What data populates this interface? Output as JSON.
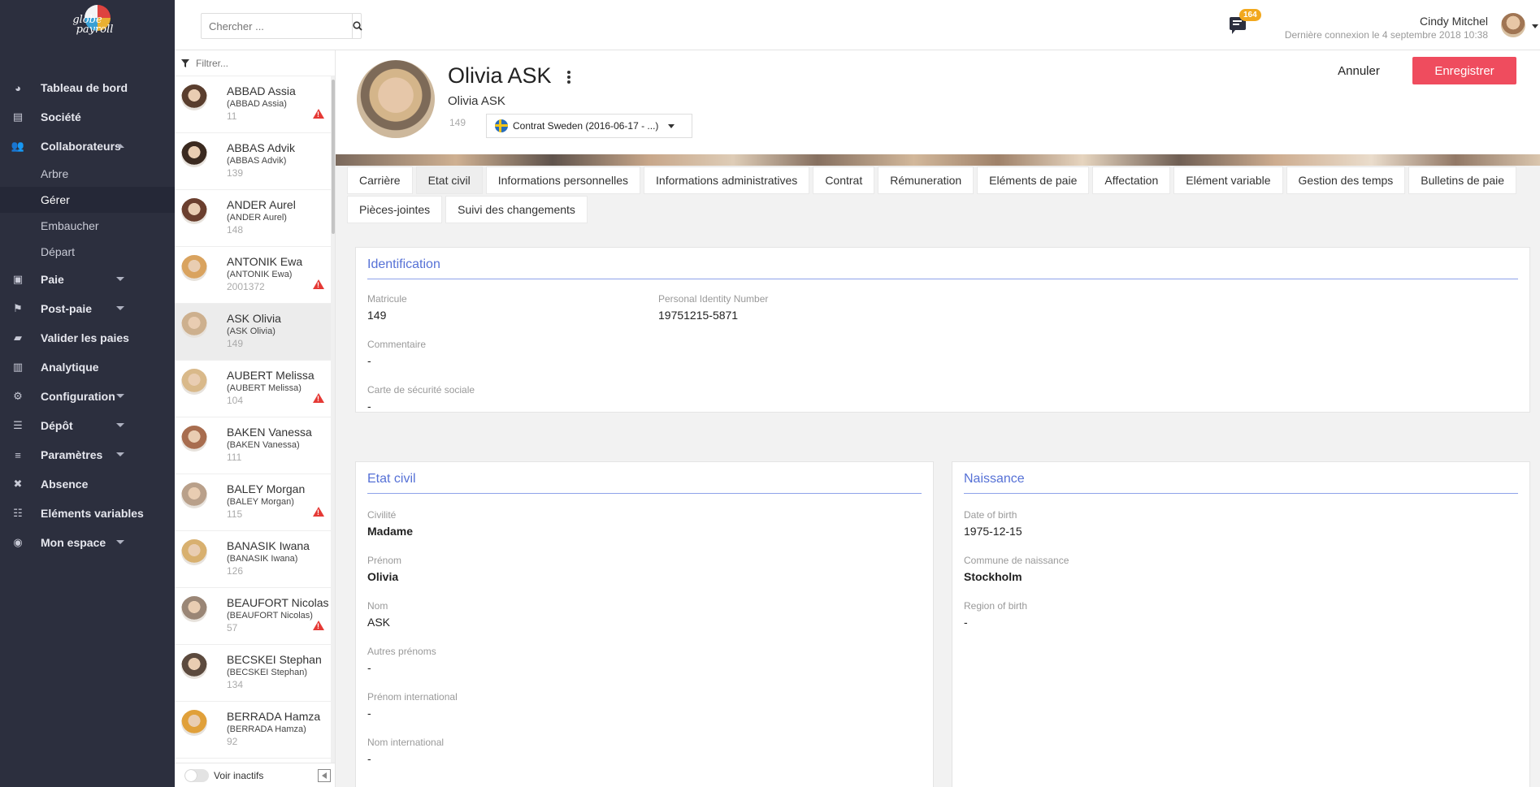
{
  "brand": {
    "line1": "globe",
    "line2": "payroll"
  },
  "nav": [
    {
      "label": "Tableau de bord",
      "icon": "dashboard-icon",
      "glyph": "◕",
      "caret": ""
    },
    {
      "label": "Société",
      "icon": "building-icon",
      "glyph": "▤",
      "caret": ""
    },
    {
      "label": "Collaborateurs",
      "icon": "users-icon",
      "glyph": "👥",
      "caret": "up"
    },
    {
      "label": "Paie",
      "icon": "money-icon",
      "glyph": "▣",
      "caret": "down"
    },
    {
      "label": "Post-paie",
      "icon": "flag-icon",
      "glyph": "⚑",
      "caret": "down"
    },
    {
      "label": "Valider les paies",
      "icon": "briefcase-icon",
      "glyph": "▰",
      "caret": ""
    },
    {
      "label": "Analytique",
      "icon": "bar-chart-icon",
      "glyph": "▥",
      "caret": ""
    },
    {
      "label": "Configuration",
      "icon": "gears-icon",
      "glyph": "⚙",
      "caret": "down"
    },
    {
      "label": "Dépôt",
      "icon": "database-icon",
      "glyph": "☰",
      "caret": "down"
    },
    {
      "label": "Paramètres",
      "icon": "sliders-icon",
      "glyph": "≡",
      "caret": "down"
    },
    {
      "label": "Absence",
      "icon": "user-x-icon",
      "glyph": "✖",
      "caret": ""
    },
    {
      "label": "Eléments variables",
      "icon": "list-icon",
      "glyph": "☷",
      "caret": ""
    },
    {
      "label": "Mon espace",
      "icon": "user-circle-icon",
      "glyph": "◉",
      "caret": "down"
    }
  ],
  "subnav": [
    {
      "label": "Arbre",
      "active": false
    },
    {
      "label": "Gérer",
      "active": true
    },
    {
      "label": "Embaucher",
      "active": false
    },
    {
      "label": "Départ",
      "active": false
    }
  ],
  "search": {
    "placeholder": "Chercher ..."
  },
  "notifications": {
    "count": "164"
  },
  "user": {
    "name": "Cindy Mitchel",
    "last_login": "Dernière connexion le 4 septembre 2018 10:38"
  },
  "employee_list": {
    "filter_placeholder": "Filtrer...",
    "inactive_label": "Voir inactifs",
    "items": [
      {
        "name": "ABBAD Assia",
        "sub": "(ABBAD Assia)",
        "id": "11",
        "warn": true,
        "active": false,
        "color": "#5a3e2e"
      },
      {
        "name": "ABBAS Advik",
        "sub": "(ABBAS Advik)",
        "id": "139",
        "warn": false,
        "active": false,
        "color": "#3b2a20"
      },
      {
        "name": "ANDER Aurel",
        "sub": "(ANDER Aurel)",
        "id": "148",
        "warn": false,
        "active": false,
        "color": "#6b3f2e"
      },
      {
        "name": "ANTONIK Ewa",
        "sub": "(ANTONIK Ewa)",
        "id": "2001372",
        "warn": true,
        "active": false,
        "color": "#d9a35f"
      },
      {
        "name": "ASK Olivia",
        "sub": "(ASK Olivia)",
        "id": "149",
        "warn": false,
        "active": true,
        "color": "#cdb08e"
      },
      {
        "name": "AUBERT Melissa",
        "sub": "(AUBERT Melissa)",
        "id": "104",
        "warn": true,
        "active": false,
        "color": "#d9b98a"
      },
      {
        "name": "BAKEN Vanessa",
        "sub": "(BAKEN Vanessa)",
        "id": "111",
        "warn": false,
        "active": false,
        "color": "#a86d4f"
      },
      {
        "name": "BALEY Morgan",
        "sub": "(BALEY Morgan)",
        "id": "115",
        "warn": true,
        "active": false,
        "color": "#b9a08a"
      },
      {
        "name": "BANASIK Iwana",
        "sub": "(BANASIK Iwana)",
        "id": "126",
        "warn": false,
        "active": false,
        "color": "#d8b06f"
      },
      {
        "name": "BEAUFORT Nicolas",
        "sub": "(BEAUFORT Nicolas)",
        "id": "57",
        "warn": true,
        "active": false,
        "color": "#9a8676"
      },
      {
        "name": "BECSKEI Stephan",
        "sub": "(BECSKEI Stephan)",
        "id": "134",
        "warn": false,
        "active": false,
        "color": "#5c4a3e"
      },
      {
        "name": "BERRADA Hamza",
        "sub": "(BERRADA Hamza)",
        "id": "92",
        "warn": false,
        "active": false,
        "color": "#e0a03a"
      }
    ]
  },
  "profile": {
    "full_name": "Olivia ASK",
    "display_name": "Olivia ASK",
    "id": "149",
    "contract": "Contrat Sweden (2016-06-17 - ...)",
    "cancel_label": "Annuler",
    "save_label": "Enregistrer"
  },
  "tabs": [
    {
      "label": "Carrière",
      "active": false
    },
    {
      "label": "Etat civil",
      "active": true
    },
    {
      "label": "Informations personnelles",
      "active": false
    },
    {
      "label": "Informations administratives",
      "active": false
    },
    {
      "label": "Contrat",
      "active": false
    },
    {
      "label": "Rémuneration",
      "active": false
    },
    {
      "label": "Eléments de paie",
      "active": false
    },
    {
      "label": "Affectation",
      "active": false
    },
    {
      "label": "Elément variable",
      "active": false
    },
    {
      "label": "Gestion des temps",
      "active": false
    },
    {
      "label": "Bulletins de paie",
      "active": false
    },
    {
      "label": "Pièces-jointes",
      "active": false
    },
    {
      "label": "Suivi des changements",
      "active": false
    }
  ],
  "identification": {
    "title": "Identification",
    "matricule_label": "Matricule",
    "matricule": "149",
    "pin_label": "Personal Identity Number",
    "pin": "19751215-5871",
    "comment_label": "Commentaire",
    "comment": "-",
    "ssn_label": "Carte de sécurité sociale",
    "ssn": "-"
  },
  "etat_civil": {
    "title": "Etat civil",
    "civilite_label": "Civilité",
    "civilite": "Madame",
    "prenom_label": "Prénom",
    "prenom": "Olivia",
    "nom_label": "Nom",
    "nom": "ASK",
    "autres_prenoms_label": "Autres prénoms",
    "autres_prenoms": "-",
    "prenom_int_label": "Prénom international",
    "prenom_int": "-",
    "nom_int_label": "Nom international",
    "nom_int": "-"
  },
  "naissance": {
    "title": "Naissance",
    "dob_label": "Date of birth",
    "dob": "1975-12-15",
    "commune_label": "Commune de naissance",
    "commune": "Stockholm",
    "region_label": "Region of birth",
    "region": "-"
  }
}
